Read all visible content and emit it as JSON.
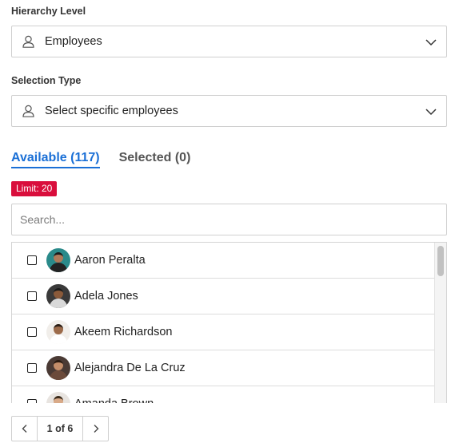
{
  "hierarchy": {
    "label": "Hierarchy Level",
    "value": "Employees",
    "icon": "person-icon"
  },
  "selection_type": {
    "label": "Selection Type",
    "value": "Select specific employees",
    "icon": "person-icon"
  },
  "tabs": [
    {
      "label": "Available (117)",
      "active": true
    },
    {
      "label": "Selected (0)",
      "active": false
    }
  ],
  "limit_badge": "Limit: 20",
  "search": {
    "placeholder": "Search...",
    "value": ""
  },
  "employees": [
    {
      "name": "Aaron Peralta",
      "checked": false,
      "avatar_bg": "#2a8a8a",
      "hair": "#1b1b1b",
      "skin": "#b07a5a",
      "shirt": "#222222"
    },
    {
      "name": "Adela Jones",
      "checked": false,
      "avatar_bg": "#3a3a3a",
      "hair": "#1a1a1a",
      "skin": "#8a5a3a",
      "shirt": "#d9d9d9"
    },
    {
      "name": "Akeem Richardson",
      "checked": false,
      "avatar_bg": "#f1eeea",
      "hair": "#2b1d14",
      "skin": "#9c6b4a",
      "shirt": "#ffffff"
    },
    {
      "name": "Alejandra De La Cruz",
      "checked": false,
      "avatar_bg": "#4a3a34",
      "hair": "#2a1a10",
      "skin": "#c48e6a",
      "shirt": "#6b4a3a"
    },
    {
      "name": "Amanda Brown",
      "checked": false,
      "avatar_bg": "#e8e4e0",
      "hair": "#3a2a1a",
      "skin": "#d9aa88",
      "shirt": "#777777"
    }
  ],
  "pagination": {
    "text": "1 of 6"
  },
  "colors": {
    "accent": "#1a6fd6",
    "limit_badge": "#d90e3c"
  }
}
